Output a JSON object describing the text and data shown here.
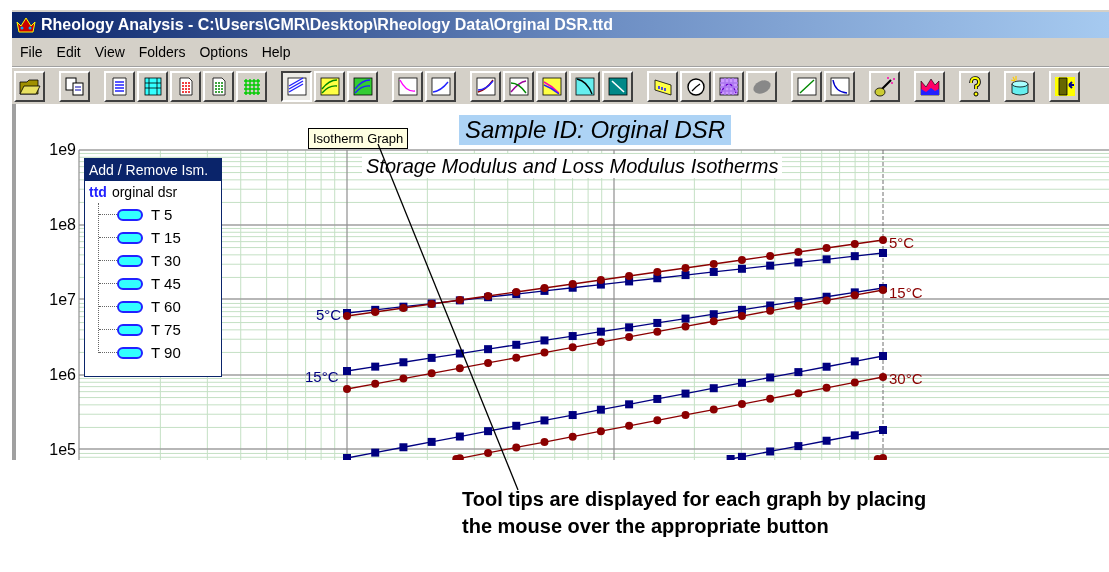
{
  "window": {
    "title": "Rheology Analysis - C:\\Users\\GMR\\Desktop\\Rheology Data\\Orginal DSR.ttd"
  },
  "menu": [
    "File",
    "Edit",
    "View",
    "Folders",
    "Options",
    "Help"
  ],
  "toolbar": [
    [
      {
        "selected": false
      }
    ],
    [
      {
        "selected": false
      }
    ],
    [
      {
        "selected": false
      },
      {
        "selected": false
      },
      {
        "selected": false
      },
      {
        "selected": false
      },
      {
        "selected": false
      }
    ],
    [
      {
        "selected": true
      },
      {
        "selected": false
      },
      {
        "selected": false
      }
    ],
    [
      {
        "selected": false
      },
      {
        "selected": false
      }
    ],
    [
      {
        "selected": false
      },
      {
        "selected": false
      },
      {
        "selected": false
      },
      {
        "selected": false
      },
      {
        "selected": false
      }
    ],
    [
      {
        "selected": false
      },
      {
        "selected": false
      },
      {
        "selected": false
      },
      {
        "selected": false
      }
    ],
    [
      {
        "selected": false
      },
      {
        "selected": false
      }
    ],
    [
      {
        "selected": false
      }
    ],
    [
      {
        "selected": false
      }
    ],
    [
      {
        "selected": false
      }
    ],
    [
      {
        "selected": false
      }
    ],
    [
      {
        "selected": false
      }
    ]
  ],
  "chart": {
    "sample_title": "Sample ID: Orginal DSR",
    "subtitle": "Storage Modulus and Loss Modulus Isotherms",
    "y_ticks": [
      "1e9",
      "1e8",
      "1e7",
      "1e6",
      "1e5"
    ],
    "left_labels": [
      "5°C",
      "15°C"
    ],
    "right_labels": [
      "5°C",
      "15°C",
      "30°C"
    ]
  },
  "tooltip": "Isotherm Graph",
  "legend": {
    "title": "Add / Remove Ism.",
    "file_tag": "ttd",
    "file_name": "orginal dsr",
    "items": [
      "T 5",
      "T 15",
      "T 30",
      "T 45",
      "T 60",
      "T 75",
      "T 90"
    ]
  },
  "annotation": "Tool tips are displayed for each graph by placing the mouse over the appropriate button"
}
